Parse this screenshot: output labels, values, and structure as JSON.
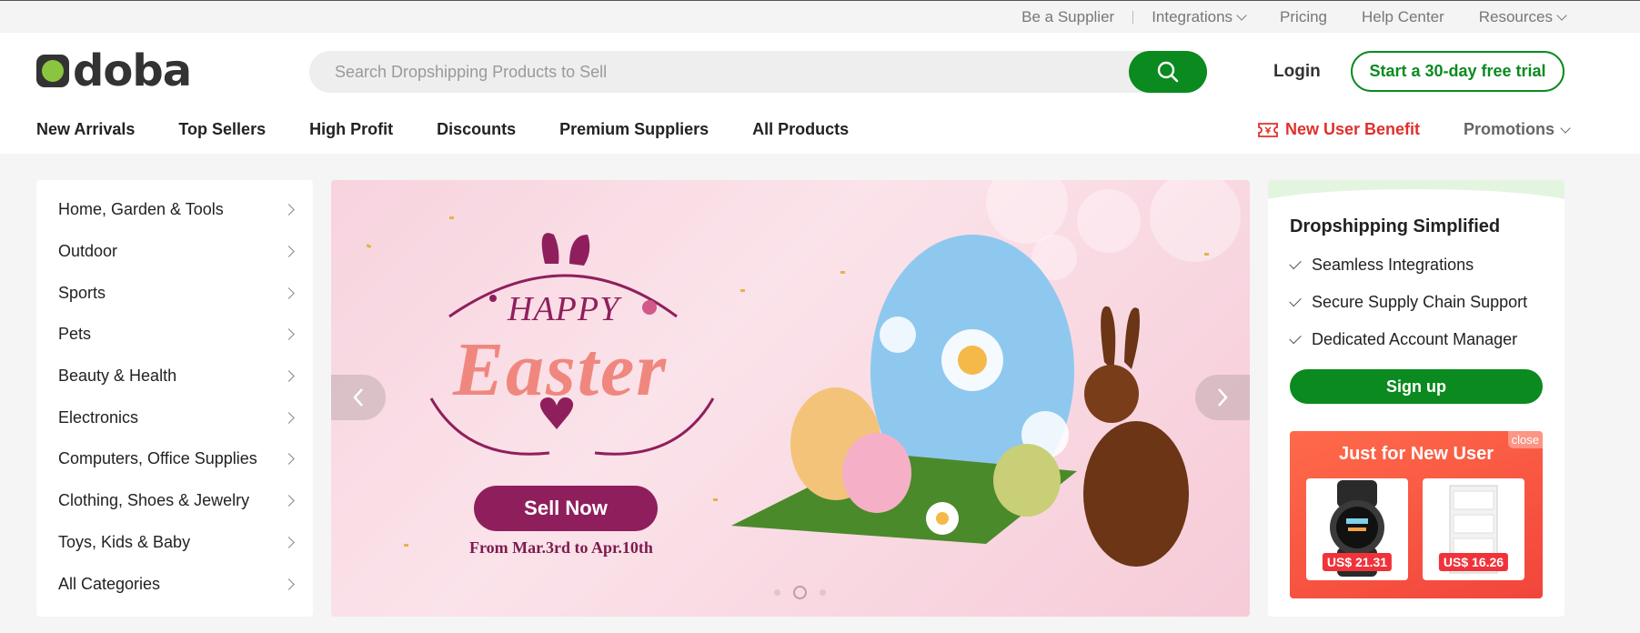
{
  "topbar": {
    "links": [
      {
        "label": "Be a Supplier"
      },
      {
        "label": "Integrations"
      },
      {
        "label": "Pricing"
      },
      {
        "label": "Help Center"
      },
      {
        "label": "Resources"
      }
    ]
  },
  "header": {
    "logo": "doba",
    "search_placeholder": "Search Dropshipping Products to Sell",
    "login": "Login",
    "trial": "Start a 30-day free trial"
  },
  "nav": {
    "items": [
      "New Arrivals",
      "Top Sellers",
      "High Profit",
      "Discounts",
      "Premium Suppliers",
      "All Products"
    ],
    "benefit": "New User Benefit",
    "promotions": "Promotions"
  },
  "categories": [
    "Home, Garden & Tools",
    "Outdoor",
    "Sports",
    "Pets",
    "Beauty & Health",
    "Electronics",
    "Computers, Office Supplies",
    "Clothing, Shoes & Jewelry",
    "Toys, Kids & Baby",
    "All Categories"
  ],
  "banner": {
    "happy": "HAPPY",
    "easter": "Easter",
    "button": "Sell Now",
    "dates": "From Mar.3rd to Apr.10th"
  },
  "side": {
    "title": "Dropshipping Simplified",
    "features": [
      "Seamless Integrations",
      "Secure Supply Chain Support",
      "Dedicated Account Manager"
    ],
    "signup": "Sign up",
    "new_user": {
      "title": "Just for New User",
      "close": "close",
      "prices": [
        "US$ 21.31",
        "US$ 16.26"
      ]
    }
  },
  "colors": {
    "brand_green": "#0b8a1f",
    "logo_green": "#8bc53f",
    "promo_red": "#e0302b",
    "banner_purple": "#8f1f5c"
  }
}
